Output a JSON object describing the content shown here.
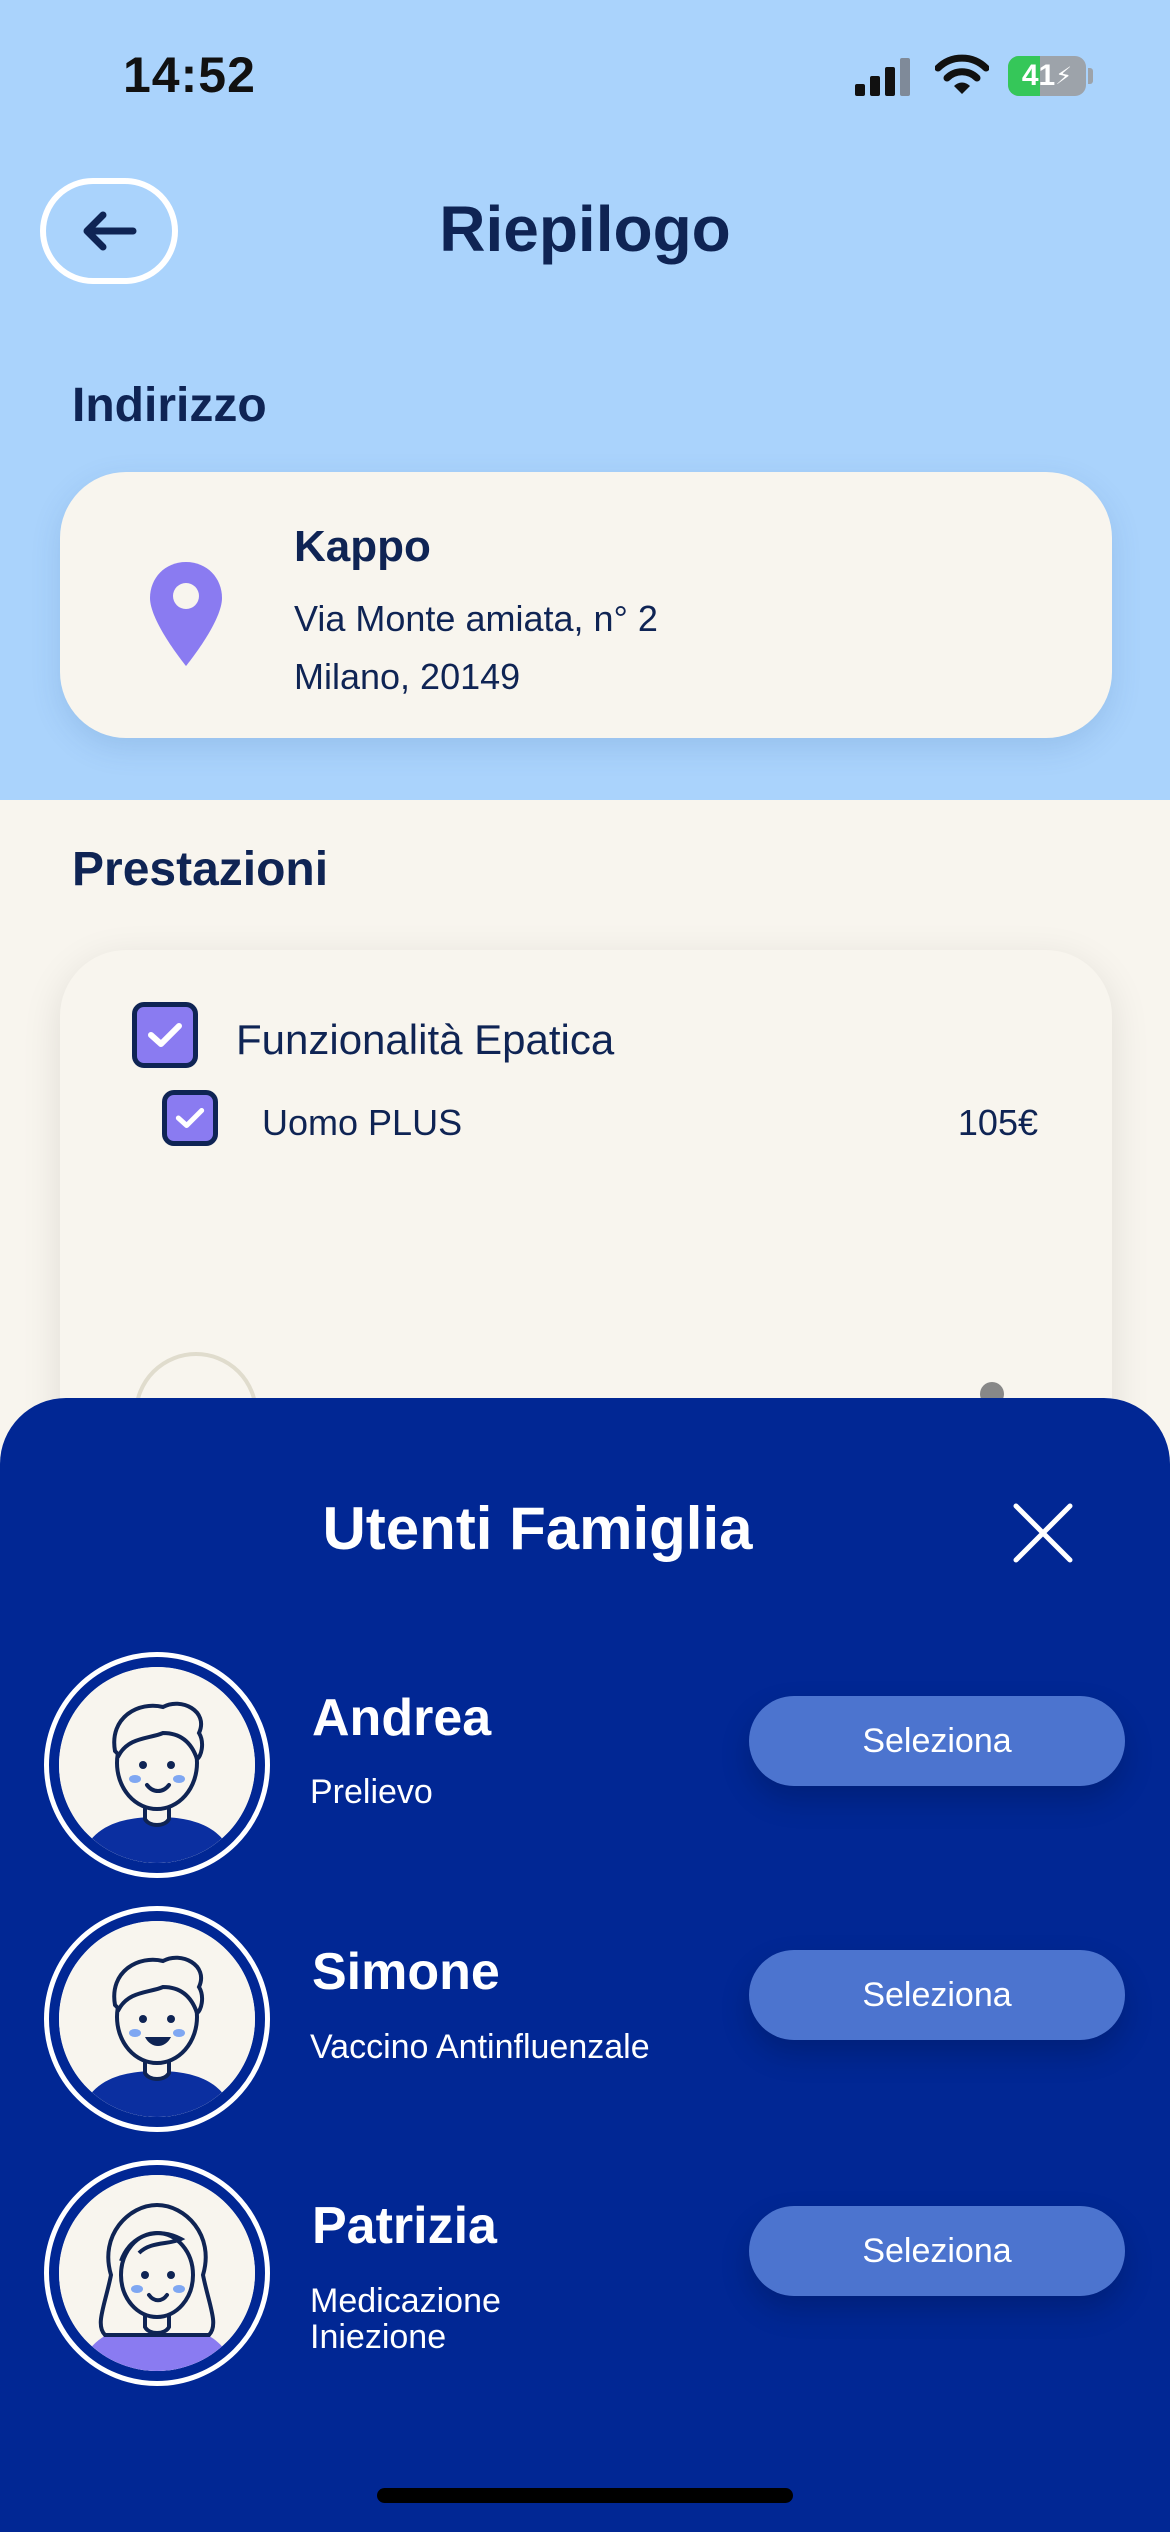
{
  "status_bar": {
    "time": "14:52",
    "battery_level": "41",
    "battery_fraction": 0.41
  },
  "header": {
    "title": "Riepilogo",
    "back_icon": "arrow-left-icon"
  },
  "address": {
    "section_label": "Indirizzo",
    "name": "Kappo",
    "line1": "Via Monte amiata, n° 2",
    "line2": "Milano, 20149",
    "icon": "map-pin-icon",
    "icon_color": "#8A7BF1"
  },
  "services": {
    "section_label": "Prestazioni",
    "items": [
      {
        "label": "Funzionalità Epatica",
        "checked": true
      },
      {
        "label": "Uomo PLUS",
        "price": "105€",
        "checked": true
      }
    ]
  },
  "family_sheet": {
    "title": "Utenti Famiglia",
    "close_icon": "close-icon",
    "users": [
      {
        "name": "Andrea",
        "subtitle": "Prelievo",
        "button": "Seleziona"
      },
      {
        "name": "Simone",
        "subtitle": "Vaccino Antinfluenzale",
        "button": "Seleziona"
      },
      {
        "name": "Patrizia",
        "subtitle_lines": [
          "Medicazione",
          "Iniezione"
        ],
        "button": "Seleziona"
      }
    ]
  },
  "colors": {
    "top_background": "#AAD3FC",
    "page_background": "#F8F5EE",
    "sheet_background": "#012794",
    "button": "#4C74CF",
    "accent_purple": "#8A7BF1",
    "text_dark": "#0F2454"
  }
}
